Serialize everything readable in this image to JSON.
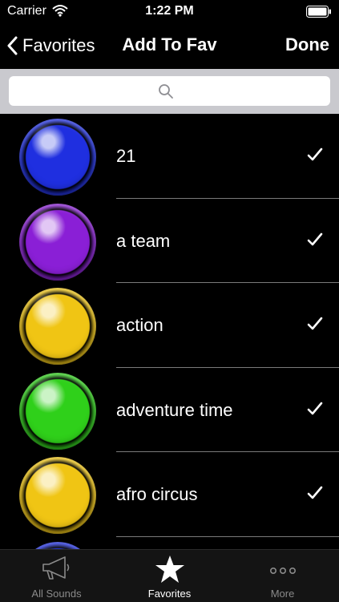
{
  "status_bar": {
    "carrier": "Carrier",
    "time": "1:22 PM"
  },
  "nav": {
    "back_label": "Favorites",
    "title": "Add To Fav",
    "done_label": "Done"
  },
  "search": {
    "placeholder": "",
    "value": ""
  },
  "rows": [
    {
      "label": "21",
      "color": "#1f2fe0",
      "checked": true
    },
    {
      "label": "a team",
      "color": "#8a1fd6",
      "checked": true
    },
    {
      "label": "action",
      "color": "#f0c514",
      "checked": true
    },
    {
      "label": "adventure time",
      "color": "#2fd01a",
      "checked": true
    },
    {
      "label": "afro circus",
      "color": "#f0c514",
      "checked": true
    },
    {
      "label": "",
      "color": "#1f2fe0",
      "checked": false
    }
  ],
  "tabs": [
    {
      "label": "All Sounds",
      "icon": "megaphone-icon"
    },
    {
      "label": "Favorites",
      "icon": "star-icon"
    },
    {
      "label": "More",
      "icon": "more-icon"
    }
  ],
  "active_tab": "Favorites"
}
